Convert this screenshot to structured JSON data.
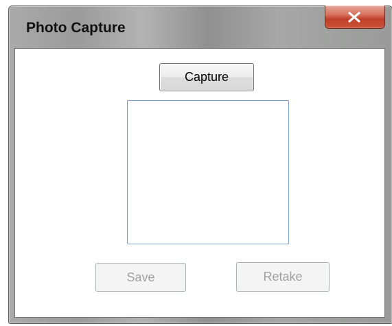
{
  "window": {
    "title": "Photo Capture",
    "close_icon": "close-icon"
  },
  "buttons": {
    "capture_label": "Capture",
    "save_label": "Save",
    "retake_label": "Retake",
    "save_enabled": false,
    "retake_enabled": false
  },
  "colors": {
    "close_button": "#c95037",
    "photo_box_border": "#7a9cc9",
    "disabled_text": "#a0a0a0"
  }
}
